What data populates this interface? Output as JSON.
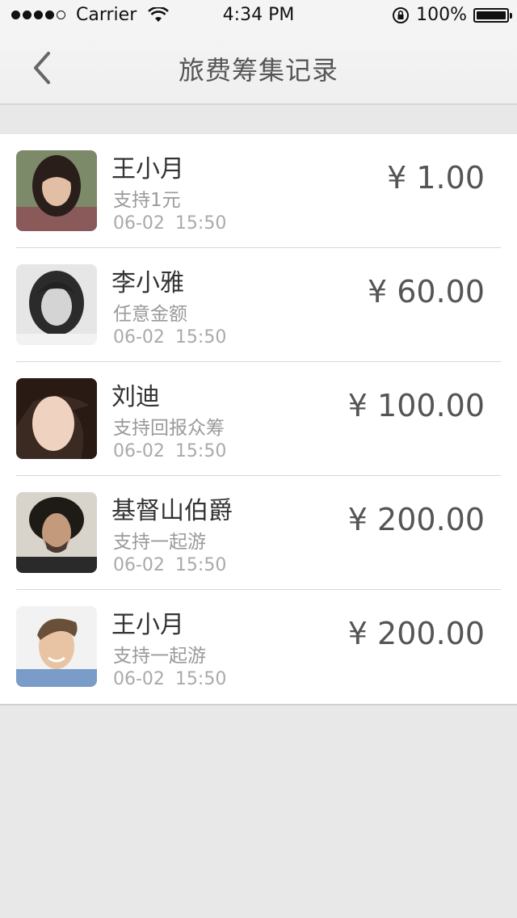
{
  "status_bar": {
    "carrier": "Carrier",
    "time": "4:34 PM",
    "battery": "100%"
  },
  "nav": {
    "title": "旅费筹集记录"
  },
  "records": [
    {
      "name": "王小月",
      "desc": "支持1元",
      "time": "06-02  15:50",
      "amount": "¥ 1.00"
    },
    {
      "name": "李小雅",
      "desc": "任意金额",
      "time": "06-02  15:50",
      "amount": "¥ 60.00"
    },
    {
      "name": "刘迪",
      "desc": "支持回报众筹",
      "time": "06-02  15:50",
      "amount": "¥ 100.00"
    },
    {
      "name": "基督山伯爵",
      "desc": "支持一起游",
      "time": "06-02  15:50",
      "amount": "¥ 200.00"
    },
    {
      "name": "王小月",
      "desc": "支持一起游",
      "time": "06-02  15:50",
      "amount": "¥ 200.00"
    }
  ],
  "colors": {
    "background": "#e8e8e8",
    "amount": "#555555",
    "secondary_text": "#9a9a9a"
  }
}
